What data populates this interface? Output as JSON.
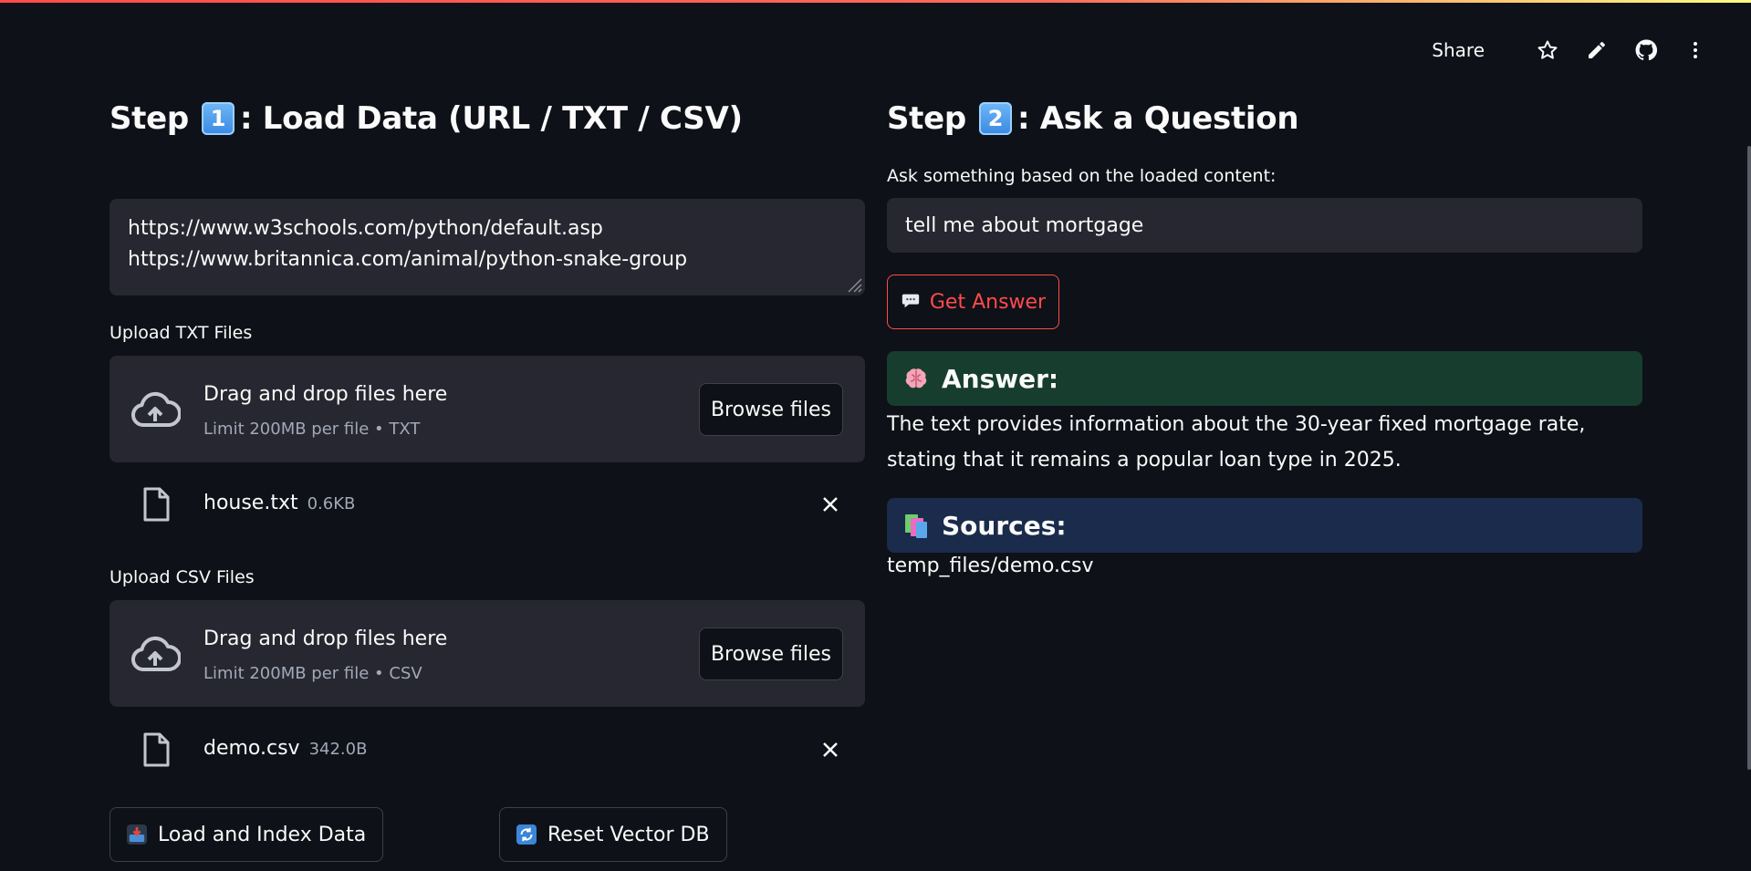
{
  "toolbar": {
    "share_label": "Share",
    "icons": [
      "star-icon",
      "pencil-icon",
      "github-icon",
      "kebab-menu-icon"
    ]
  },
  "step1": {
    "title_prefix": "Step",
    "keycap": "1",
    "title_suffix": ": Load Data (URL / TXT / CSV)",
    "urls_value": "https://www.w3schools.com/python/default.asp\nhttps://www.britannica.com/animal/python-snake-group",
    "txt_upload": {
      "label": "Upload TXT Files",
      "drop_title": "Drag and drop files here",
      "drop_sub": "Limit 200MB per file • TXT",
      "browse_label": "Browse files",
      "file": {
        "name": "house.txt",
        "size": "0.6KB"
      }
    },
    "csv_upload": {
      "label": "Upload CSV Files",
      "drop_title": "Drag and drop files here",
      "drop_sub": "Limit 200MB per file • CSV",
      "browse_label": "Browse files",
      "file": {
        "name": "demo.csv",
        "size": "342.0B"
      }
    },
    "load_button": "Load and Index Data",
    "reset_button": "Reset Vector DB"
  },
  "step2": {
    "title_prefix": "Step",
    "keycap": "2",
    "title_suffix": ": Ask a Question",
    "question_label": "Ask something based on the loaded content:",
    "question_value": "tell me about mortgage",
    "get_answer_label": "Get Answer",
    "answer_heading": "Answer:",
    "answer_text": "The text provides information about the 30-year fixed mortgage rate, stating that it remains a popular loan type in 2025.",
    "sources_heading": "Sources:",
    "source_item": "temp_files/demo.csv"
  },
  "colors": {
    "background": "#0e1117",
    "panel": "#262730",
    "accent": "#ff4b4b",
    "answer_bg": "#173d2f",
    "sources_bg": "#1a2b4b"
  }
}
